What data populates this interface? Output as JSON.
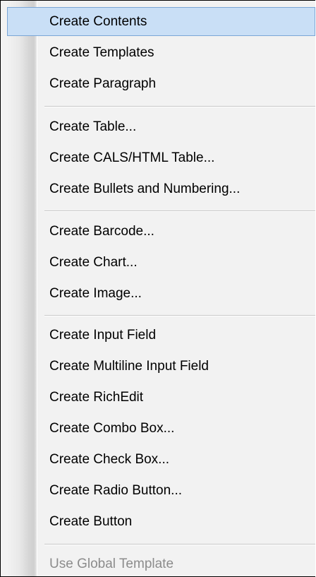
{
  "menu": {
    "items": [
      {
        "label": "Create Contents",
        "state": "selected"
      },
      {
        "label": "Create Templates",
        "state": "normal"
      },
      {
        "label": "Create Paragraph",
        "state": "normal"
      },
      {
        "label": "Create Table...",
        "state": "normal"
      },
      {
        "label": "Create CALS/HTML Table...",
        "state": "normal"
      },
      {
        "label": "Create Bullets and Numbering...",
        "state": "normal"
      },
      {
        "label": "Create Barcode...",
        "state": "normal"
      },
      {
        "label": "Create Chart...",
        "state": "normal"
      },
      {
        "label": "Create Image...",
        "state": "normal"
      },
      {
        "label": "Create Input Field",
        "state": "normal"
      },
      {
        "label": "Create Multiline Input Field",
        "state": "normal"
      },
      {
        "label": "Create RichEdit",
        "state": "normal"
      },
      {
        "label": "Create Combo Box...",
        "state": "normal"
      },
      {
        "label": "Create Check Box...",
        "state": "normal"
      },
      {
        "label": "Create Radio Button...",
        "state": "normal"
      },
      {
        "label": "Create Button",
        "state": "normal"
      },
      {
        "label": "Use Global Template",
        "state": "disabled"
      }
    ]
  },
  "colors": {
    "highlight": "#c9dff6",
    "highlight_border": "#7aa6d6",
    "menu_background": "#f2f2f2",
    "disabled_text": "#8c8c8c"
  }
}
